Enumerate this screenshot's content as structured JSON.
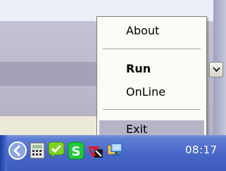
{
  "context_menu": {
    "items": [
      {
        "label": "About",
        "bold": false,
        "highlighted": false
      },
      {
        "label": "Run",
        "bold": true,
        "highlighted": false
      },
      {
        "label": "OnLine",
        "bold": false,
        "highlighted": false
      },
      {
        "label": "Exit",
        "bold": false,
        "highlighted": true
      }
    ]
  },
  "tray": {
    "clock": "08:17",
    "icons": [
      "chevron-left-icon",
      "calculator-icon",
      "chat-bubble-icon",
      "s-app-icon",
      "network-alert-icon",
      "monitor-icon"
    ]
  },
  "colors": {
    "menu_highlight": "#b5b4c7",
    "taskbar": "#4867c9"
  }
}
